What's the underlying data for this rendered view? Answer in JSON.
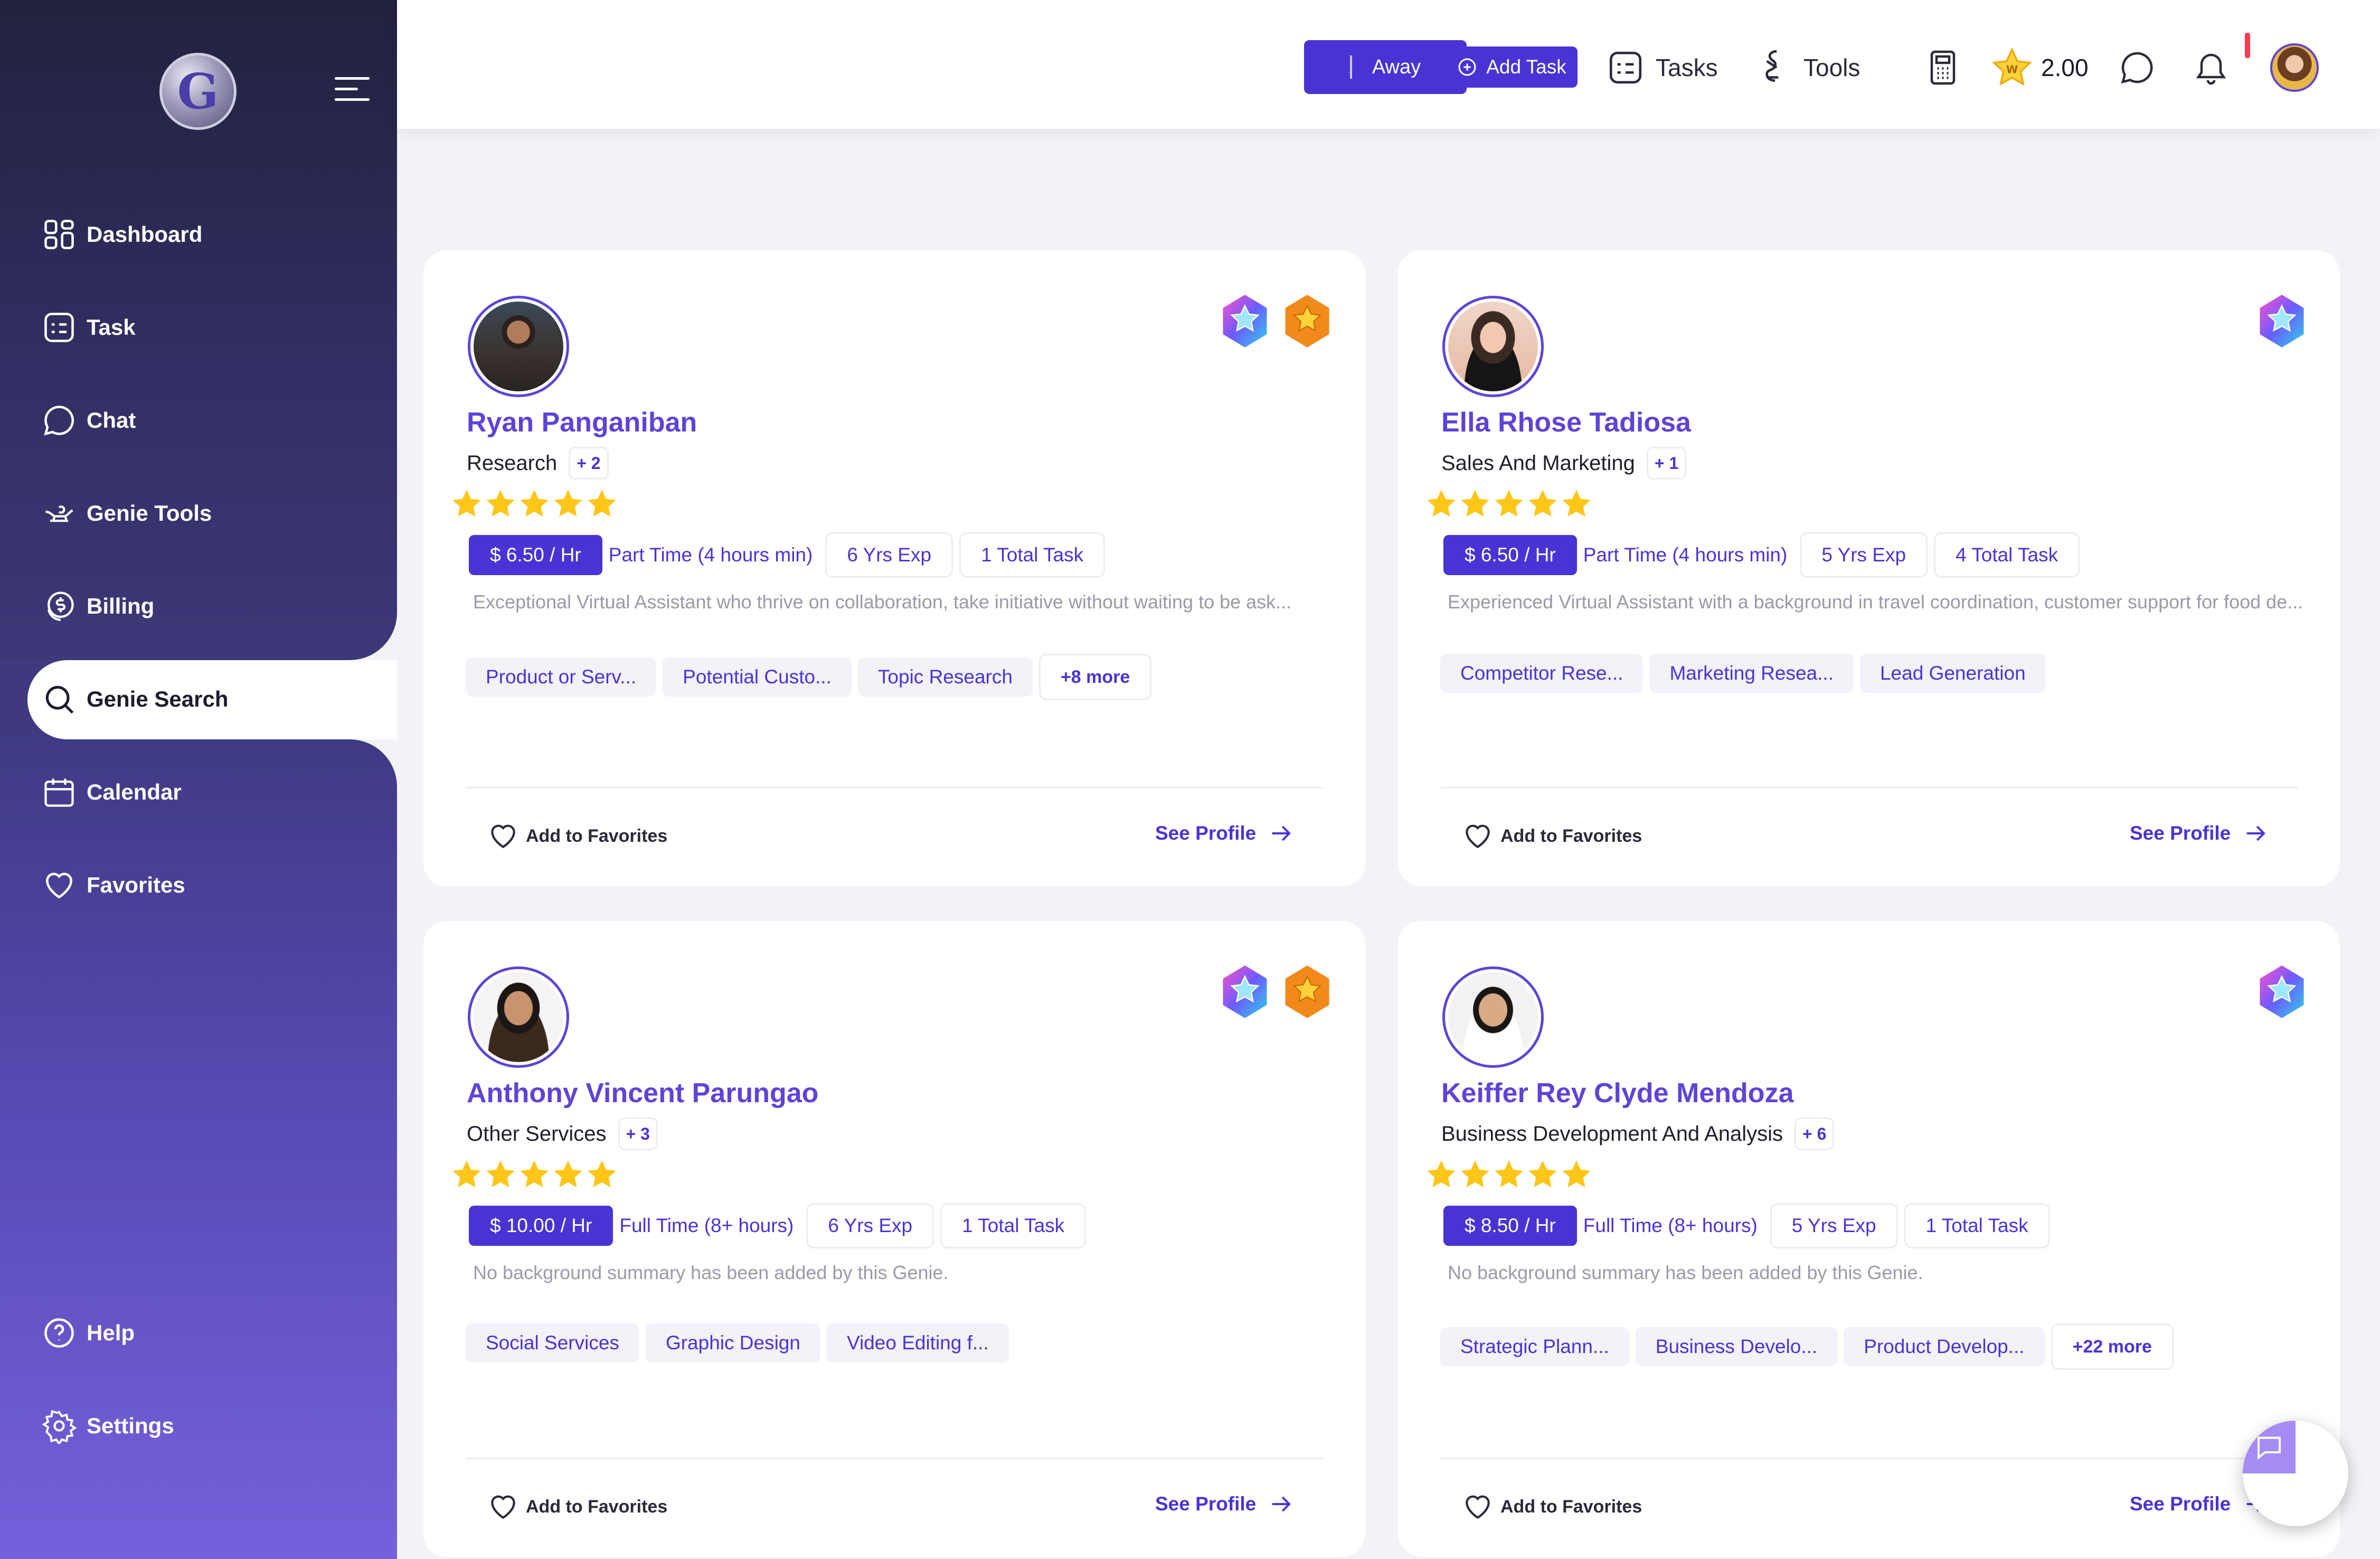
{
  "brand": {
    "logo_letter": "G",
    "accent": "#4834d4",
    "name_color": "#5b45d6"
  },
  "sidebar": {
    "items": [
      {
        "label": "Dashboard",
        "icon": "grid-icon"
      },
      {
        "label": "Task",
        "icon": "task-icon"
      },
      {
        "label": "Chat",
        "icon": "chat-bubble-icon"
      },
      {
        "label": "Genie Tools",
        "icon": "genie-lamp-icon"
      },
      {
        "label": "Billing",
        "icon": "dollar-coin-icon"
      },
      {
        "label": "Genie Search",
        "icon": "search-icon",
        "active": true
      },
      {
        "label": "Calendar",
        "icon": "calendar-icon"
      },
      {
        "label": "Favorites",
        "icon": "heart-icon"
      }
    ],
    "bottom_items": [
      {
        "label": "Help",
        "icon": "help-circle-icon"
      },
      {
        "label": "Settings",
        "icon": "gear-icon"
      }
    ]
  },
  "header": {
    "away_label": "Away",
    "add_task_label": "Add Task",
    "tasks_label": "Tasks",
    "tools_label": "Tools",
    "points_value": "2.00",
    "icons": [
      "calculator-icon",
      "star-coin-icon",
      "chat-icon",
      "bell-icon",
      "user-avatar"
    ]
  },
  "cards": [
    {
      "name": "Ryan Panganiban",
      "category": "Research",
      "category_more": "+ 2",
      "rating": 5,
      "rate": "$ 6.50 / Hr",
      "availability": "Part Time (4 hours min)",
      "experience": "6 Yrs Exp",
      "tasks": "1 Total Task",
      "summary": "Exceptional Virtual Assistant who thrive on collaboration, take initiative without waiting to be ask...",
      "skills": [
        "Product or Serv...",
        "Potential Custo...",
        "Topic Research"
      ],
      "skills_more": "+8 more",
      "badges": [
        "rainbow-star-badge",
        "gold-star-badge"
      ],
      "favorite_label": "Add to Favorites",
      "profile_label": "See Profile"
    },
    {
      "name": "Ella Rhose Tadiosa",
      "category": "Sales And Marketing",
      "category_more": "+ 1",
      "rating": 5,
      "rate": "$ 6.50 / Hr",
      "availability": "Part Time (4 hours min)",
      "experience": "5 Yrs Exp",
      "tasks": "4 Total Task",
      "summary": "Experienced Virtual Assistant with a background in travel coordination, customer support for food de...",
      "skills": [
        "Competitor Rese...",
        "Marketing Resea...",
        "Lead Generation"
      ],
      "skills_more": "",
      "badges": [
        "rainbow-star-badge"
      ],
      "favorite_label": "Add to Favorites",
      "profile_label": "See Profile"
    },
    {
      "name": "Anthony Vincent Parungao",
      "category": "Other Services",
      "category_more": "+ 3",
      "rating": 5,
      "rate": "$ 10.00 / Hr",
      "availability": "Full Time (8+ hours)",
      "experience": "6 Yrs Exp",
      "tasks": "1 Total Task",
      "summary": "No background summary has been added by this Genie.",
      "skills": [
        "Social Services",
        "Graphic Design",
        "Video Editing f..."
      ],
      "skills_more": "",
      "badges": [
        "rainbow-star-badge",
        "gold-star-badge"
      ],
      "favorite_label": "Add to Favorites",
      "profile_label": "See Profile"
    },
    {
      "name": "Keiffer Rey Clyde Mendoza",
      "category": "Business Development And Analysis",
      "category_more": "+ 6",
      "rating": 5,
      "rate": "$ 8.50 / Hr",
      "availability": "Full Time (8+ hours)",
      "experience": "5 Yrs Exp",
      "tasks": "1 Total Task",
      "summary": "No background summary has been added by this Genie.",
      "skills": [
        "Strategic Plann...",
        "Business Develo...",
        "Product Develop..."
      ],
      "skills_more": "+22 more",
      "badges": [
        "rainbow-star-badge"
      ],
      "favorite_label": "Add to Favorites",
      "profile_label": "See Profile"
    }
  ]
}
